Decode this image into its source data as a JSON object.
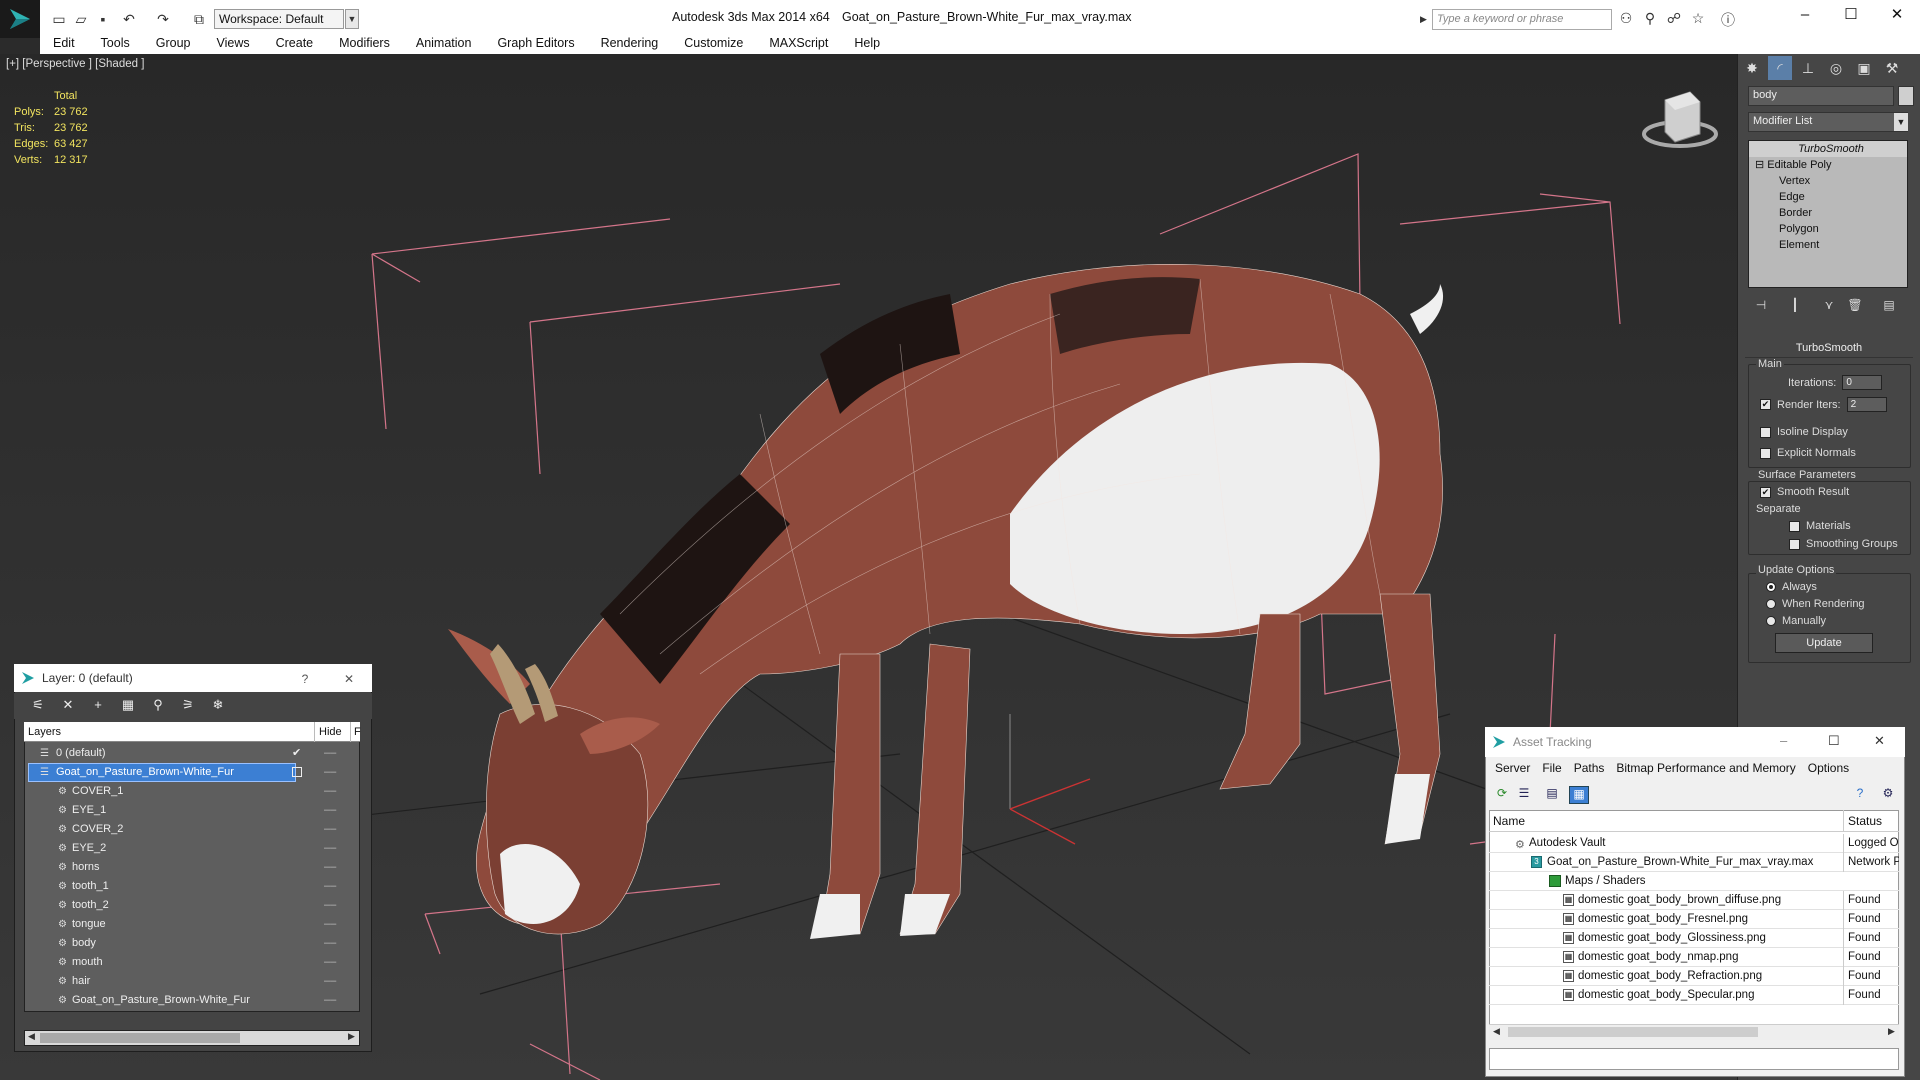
{
  "titlebar": {
    "workspace_label": "Workspace: Default",
    "app_name": "Autodesk 3ds Max  2014 x64",
    "file_name": "Goat_on_Pasture_Brown-White_Fur_max_vray.max",
    "search_placeholder": "Type a keyword or phrase"
  },
  "menubar": [
    "Edit",
    "Tools",
    "Group",
    "Views",
    "Create",
    "Modifiers",
    "Animation",
    "Graph Editors",
    "Rendering",
    "Customize",
    "MAXScript",
    "Help"
  ],
  "viewport": {
    "label": "[+] [Perspective ] [Shaded ]",
    "stats_header": "Total",
    "stats": [
      {
        "label": "Polys:",
        "value": "23 762"
      },
      {
        "label": "Tris:",
        "value": "23 762"
      },
      {
        "label": "Edges:",
        "value": "63 427"
      },
      {
        "label": "Verts:",
        "value": "12 317"
      }
    ]
  },
  "command_panel": {
    "object_name": "body",
    "modifier_list": "Modifier List",
    "stack": {
      "turbosmooth": "TurboSmooth",
      "editable_poly": "Editable Poly",
      "subobjects": [
        "Vertex",
        "Edge",
        "Border",
        "Polygon",
        "Element"
      ]
    },
    "rollout_title": "TurboSmooth",
    "main_group": "Main",
    "iterations_label": "Iterations:",
    "iterations_value": "0",
    "render_iters_label": "Render Iters:",
    "render_iters_value": "2",
    "isoline_label": "Isoline Display",
    "explicit_normals_label": "Explicit Normals",
    "surface_group": "Surface Parameters",
    "smooth_result_label": "Smooth Result",
    "separate_label": "Separate",
    "materials_label": "Materials",
    "smoothing_groups_label": "Smoothing Groups",
    "update_group": "Update Options",
    "update_options": [
      "Always",
      "When Rendering",
      "Manually"
    ],
    "update_button": "Update"
  },
  "layer_dialog": {
    "title": "Layer: 0 (default)",
    "help": "?",
    "col_layers": "Layers",
    "col_hide": "Hide",
    "col_f": "F",
    "layers": [
      {
        "name": "0 (default)",
        "indent": 0
      },
      {
        "name": "Goat_on_Pasture_Brown-White_Fur",
        "indent": 0,
        "selected": true
      },
      {
        "name": "COVER_1",
        "indent": 1
      },
      {
        "name": "EYE_1",
        "indent": 1
      },
      {
        "name": "COVER_2",
        "indent": 1
      },
      {
        "name": "EYE_2",
        "indent": 1
      },
      {
        "name": "horns",
        "indent": 1
      },
      {
        "name": "tooth_1",
        "indent": 1
      },
      {
        "name": "tooth_2",
        "indent": 1
      },
      {
        "name": "tongue",
        "indent": 1
      },
      {
        "name": "body",
        "indent": 1
      },
      {
        "name": "mouth",
        "indent": 1
      },
      {
        "name": "hair",
        "indent": 1
      },
      {
        "name": "Goat_on_Pasture_Brown-White_Fur",
        "indent": 1
      }
    ]
  },
  "asset_dialog": {
    "title": "Asset Tracking",
    "menu": [
      "Server",
      "File",
      "Paths",
      "Bitmap Performance and Memory",
      "Options"
    ],
    "col_name": "Name",
    "col_status": "Status",
    "rows": [
      {
        "name": "Autodesk Vault",
        "status": "Logged Ou",
        "indent": 1
      },
      {
        "name": "Goat_on_Pasture_Brown-White_Fur_max_vray.max",
        "status": "Network P",
        "indent": 2
      },
      {
        "name": "Maps / Shaders",
        "status": "",
        "indent": 3
      },
      {
        "name": "domestic goat_body_brown_diffuse.png",
        "status": "Found",
        "indent": 4
      },
      {
        "name": "domestic goat_body_Fresnel.png",
        "status": "Found",
        "indent": 4
      },
      {
        "name": "domestic goat_body_Glossiness.png",
        "status": "Found",
        "indent": 4
      },
      {
        "name": "domestic goat_body_nmap.png",
        "status": "Found",
        "indent": 4
      },
      {
        "name": "domestic goat_body_Refraction.png",
        "status": "Found",
        "indent": 4
      },
      {
        "name": "domestic goat_body_Specular.png",
        "status": "Found",
        "indent": 4
      }
    ]
  }
}
